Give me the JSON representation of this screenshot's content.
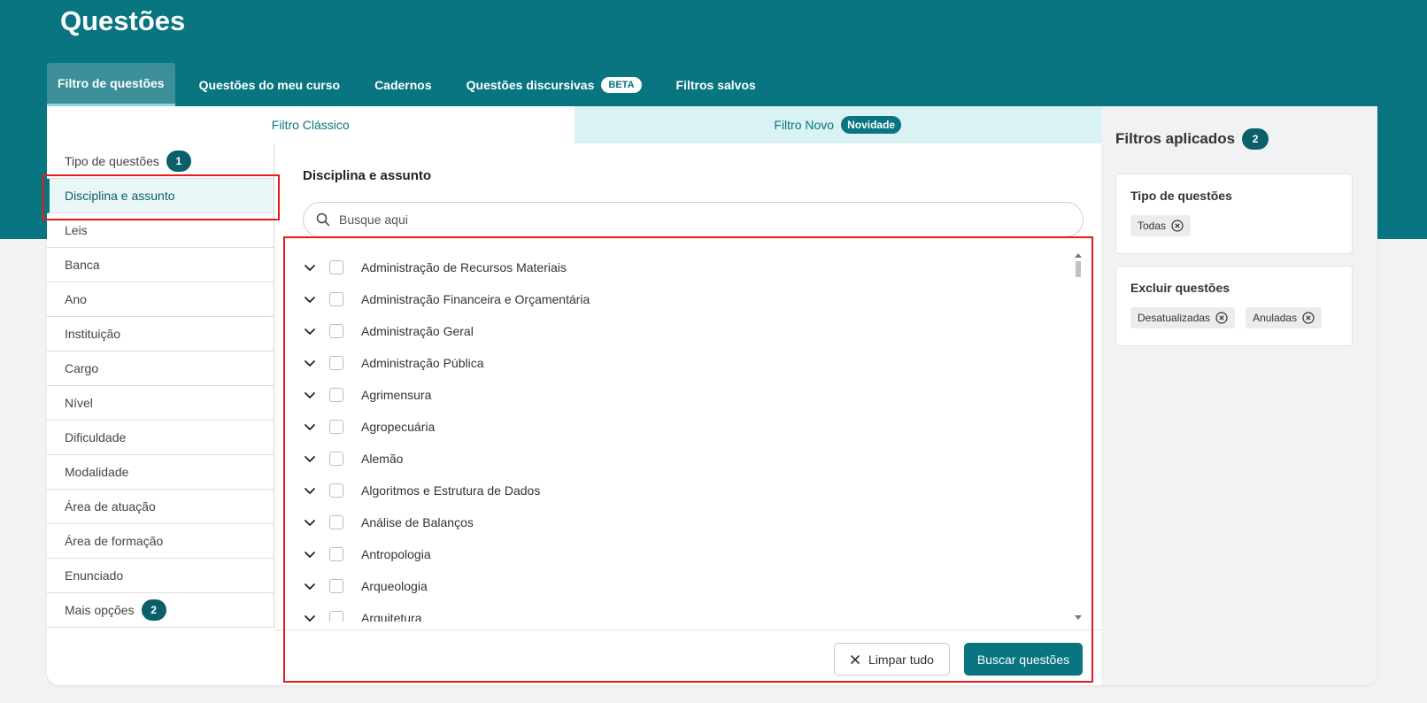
{
  "page": {
    "title": "Questões"
  },
  "top_tabs": [
    {
      "label": "Filtro de questões",
      "active": true
    },
    {
      "label": "Questões do meu curso"
    },
    {
      "label": "Cadernos"
    },
    {
      "label": "Questões discursivas",
      "badge": "BETA"
    },
    {
      "label": "Filtros salvos"
    }
  ],
  "filter_tabs": {
    "classic": "Filtro Clássico",
    "new": "Filtro Novo",
    "new_badge": "Novidade"
  },
  "sidebar": {
    "items": [
      {
        "label": "Tipo de questões",
        "badge": "1"
      },
      {
        "label": "Disciplina e assunto",
        "active": true
      },
      {
        "label": "Leis"
      },
      {
        "label": "Banca"
      },
      {
        "label": "Ano"
      },
      {
        "label": "Instituição"
      },
      {
        "label": "Cargo"
      },
      {
        "label": "Nível"
      },
      {
        "label": "Dificuldade"
      },
      {
        "label": "Modalidade"
      },
      {
        "label": "Área de atuação"
      },
      {
        "label": "Área de formação"
      },
      {
        "label": "Enunciado"
      },
      {
        "label": "Mais opções",
        "badge": "2"
      }
    ]
  },
  "content": {
    "title": "Disciplina e assunto",
    "search_placeholder": "Busque aqui",
    "subjects": [
      "Administração de Recursos Materiais",
      "Administração Financeira e Orçamentária",
      "Administração Geral",
      "Administração Pública",
      "Agrimensura",
      "Agropecuária",
      "Alemão",
      "Algoritmos e Estrutura de Dados",
      "Análise de Balanços",
      "Antropologia",
      "Arqueologia",
      "Arquitetura"
    ]
  },
  "footer": {
    "clear_label": "Limpar tudo",
    "search_label": "Buscar questões"
  },
  "applied": {
    "title": "Filtros aplicados",
    "count": "2",
    "groups": [
      {
        "title": "Tipo de questões",
        "chips": [
          "Todas"
        ]
      },
      {
        "title": "Excluir questões",
        "chips": [
          "Desatualizadas",
          "Anuladas"
        ]
      }
    ]
  },
  "colors": {
    "brand": "#087580",
    "highlight": "#e31c1c"
  }
}
